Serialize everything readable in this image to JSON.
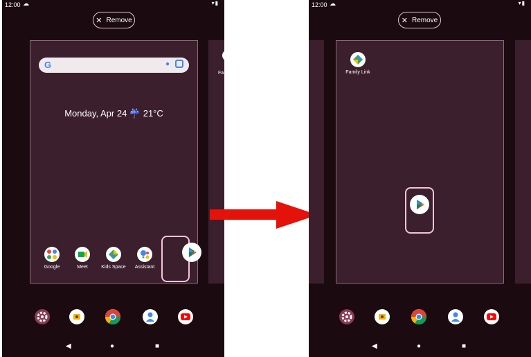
{
  "status_bar": {
    "time": "12:00"
  },
  "remove_label": "Remove",
  "left_screen": {
    "date_weather": "Monday, Apr 24 ☔ 21°C",
    "apps": [
      {
        "label": "Google",
        "icon": "google-folder-icon"
      },
      {
        "label": "Meet",
        "icon": "meet-icon"
      },
      {
        "label": "Kids Space",
        "icon": "kids-space-icon"
      },
      {
        "label": "Assistant",
        "icon": "assistant-icon"
      }
    ],
    "dragged_icon": "play-store-icon",
    "peek_label": "Fa"
  },
  "right_screen": {
    "app": {
      "label": "Family Link",
      "icon": "family-link-icon"
    },
    "dropped_icon": "play-store-icon"
  },
  "dock": [
    "settings-icon",
    "camera-icon",
    "chrome-icon",
    "contacts-icon",
    "youtube-icon"
  ],
  "nav": {
    "back": "◀",
    "home": "●",
    "recents": "■"
  },
  "colors": {
    "arrow": "#e3120b",
    "highlight": "#f2c6dc",
    "panel": "#3b1f2c",
    "background": "#1b0b10"
  }
}
